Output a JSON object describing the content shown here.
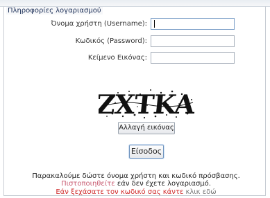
{
  "section": {
    "title": "Πληροφορίες λογαριασμού"
  },
  "form": {
    "username_label": "Όνομα χρήστη (Username):",
    "password_label": "Κωδικός (Password):",
    "image_text_label": "Κείμενο Εικόνας:",
    "username_value": "",
    "password_value": "",
    "image_text_value": ""
  },
  "captcha": {
    "text": "ZXTKA"
  },
  "buttons": {
    "change_image": "Αλλαγή εικόνας",
    "login": "Είσοδος"
  },
  "notice": {
    "line1": "Παρακαλούμε δώστε όνομα χρήστη και κωδικό πρόσβασης.",
    "line2_link": "Πιστοποιηθείτε",
    "line2_text": "εάν δεν έχετε λογαριασμό.",
    "line3_text": "Εάν ξεχάσατε τον κωδικό σας κάντε",
    "line3_link": "κλικ εδώ"
  },
  "colors": {
    "legend_text": "#1c2f57",
    "link_red": "#cf2b2b",
    "link_pink": "#c85a70",
    "input_border": "#a9b1bc"
  }
}
